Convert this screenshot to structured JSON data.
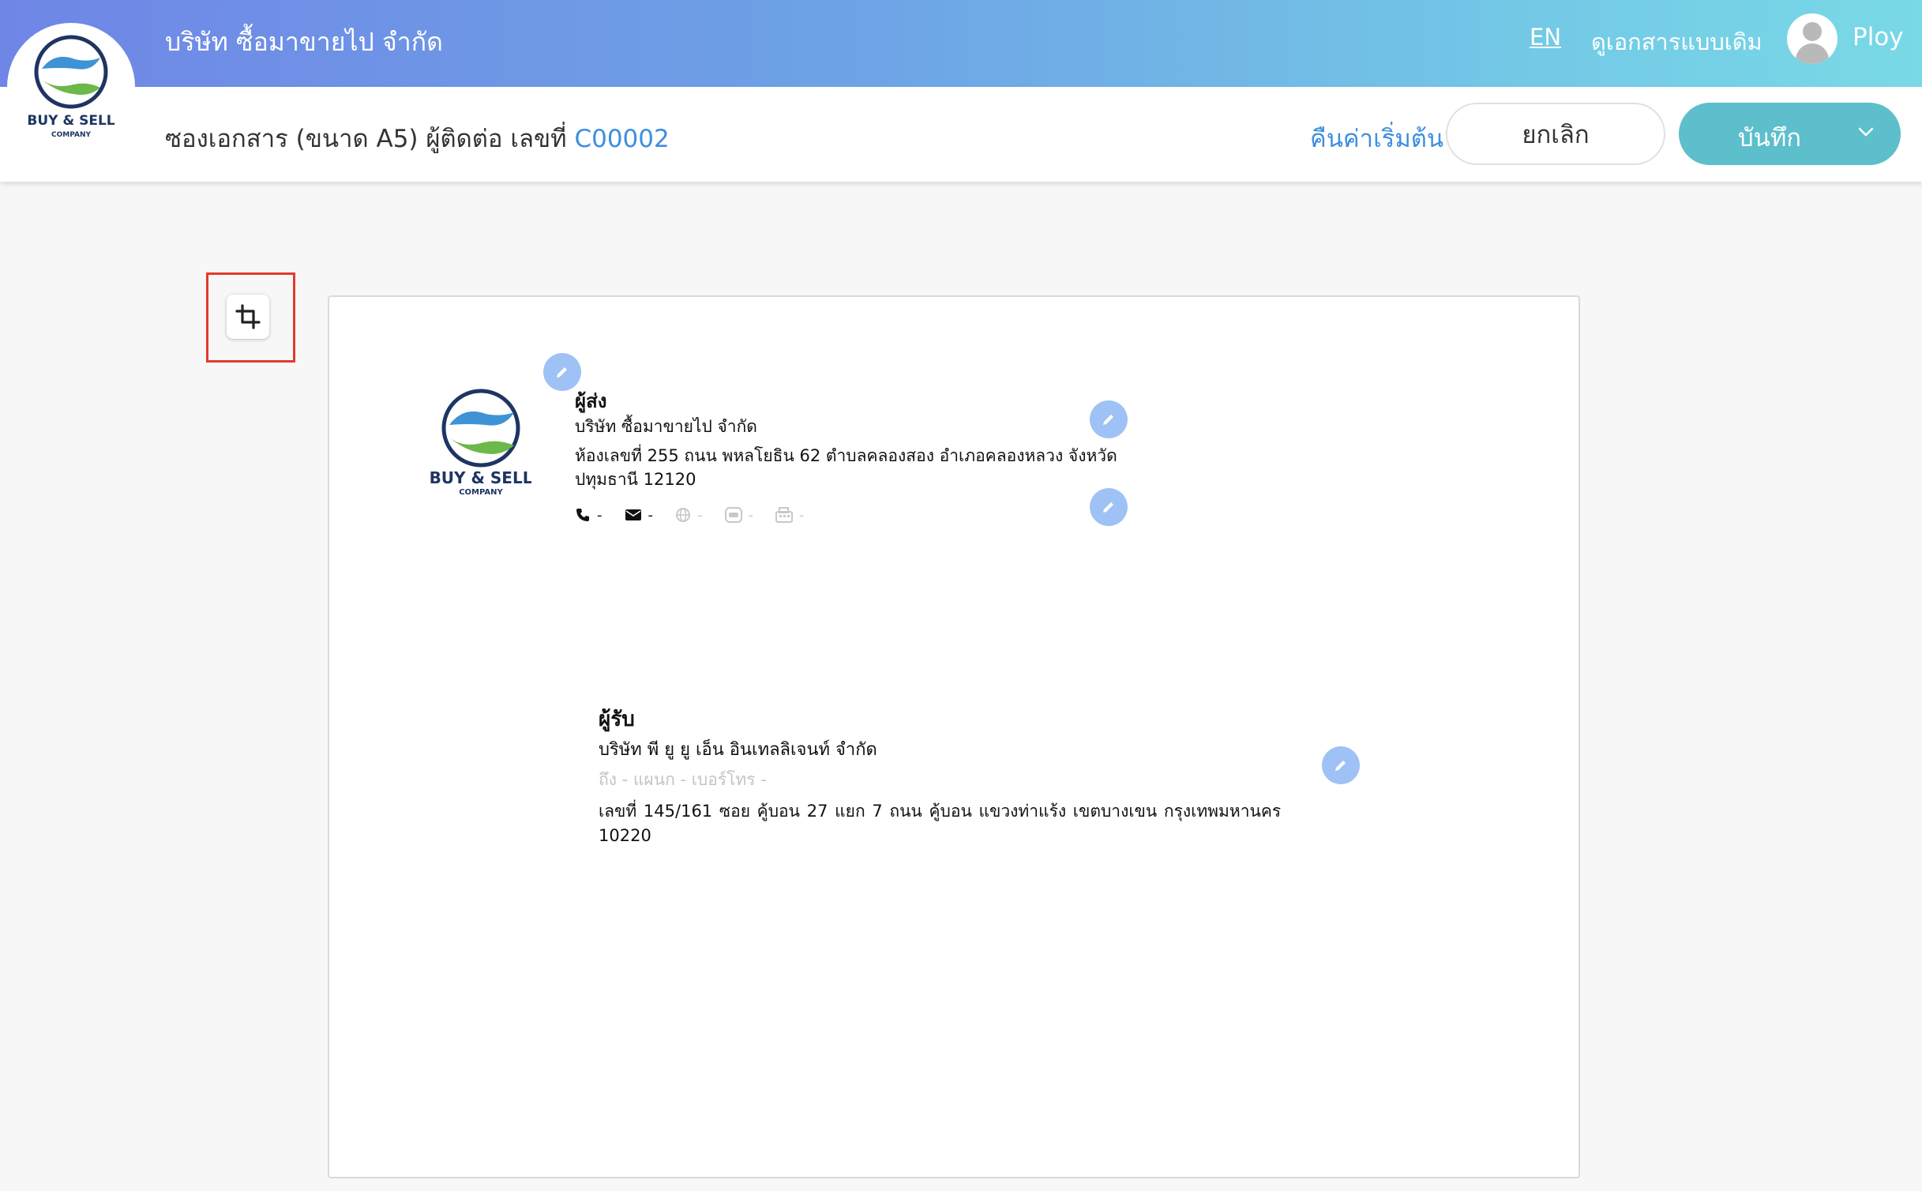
{
  "header": {
    "company_title": "บริษัท ซื้อมาขายไป จำกัด",
    "lang_toggle": "EN",
    "old_doc_link": "ดูเอกสารแบบเดิม",
    "username": "Ploy",
    "gradient_colors": [
      "#6f86e6",
      "#79d9e6"
    ]
  },
  "logo": {
    "line1": "BUY & SELL",
    "line2": "COMPANY"
  },
  "toolbar": {
    "doc_title": "ซองเอกสาร (ขนาด A5) ผู้ติดต่อ เลขที่",
    "doc_code": "C00002",
    "reset_label": "คืนค่าเริ่มต้น",
    "cancel_label": "ยกเลิก",
    "save_label": "บันทึก",
    "save_color": "#5cbfcb",
    "link_color": "#3d8ee0"
  },
  "crop_tool": {
    "icon": "crop-icon",
    "highlight_color": "#e33a2c"
  },
  "sender": {
    "heading": "ผู้ส่ง",
    "name": "บริษัท ซื้อมาขายไป จำกัด",
    "address": "ห้องเลขที่ 255 ถนน พหลโยธิน 62 ตำบลคลองสอง อำเภอคลองหลวง จังหวัด ปทุมธานี 12120",
    "contacts": [
      {
        "icon": "phone-icon",
        "value": "-"
      },
      {
        "icon": "envelope-icon",
        "value": "-"
      },
      {
        "icon": "globe-icon",
        "value": "-"
      },
      {
        "icon": "line-icon",
        "value": "-"
      },
      {
        "icon": "fax-icon",
        "value": "-"
      }
    ]
  },
  "receiver": {
    "heading": "ผู้รับ",
    "name": "บริษัท พี ยู ยู เอ็น อินเทลลิเจนท์ จำกัด",
    "to_line": "ถึง - แผนก - เบอร์โทร -",
    "address": "เลขที่ 145/161     ซอย คู้บอน 27 แยก 7 ถนน คู้บอน  แขวงท่าแร้ง เขตบางเขน กรุงเทพมหานคร 10220"
  }
}
